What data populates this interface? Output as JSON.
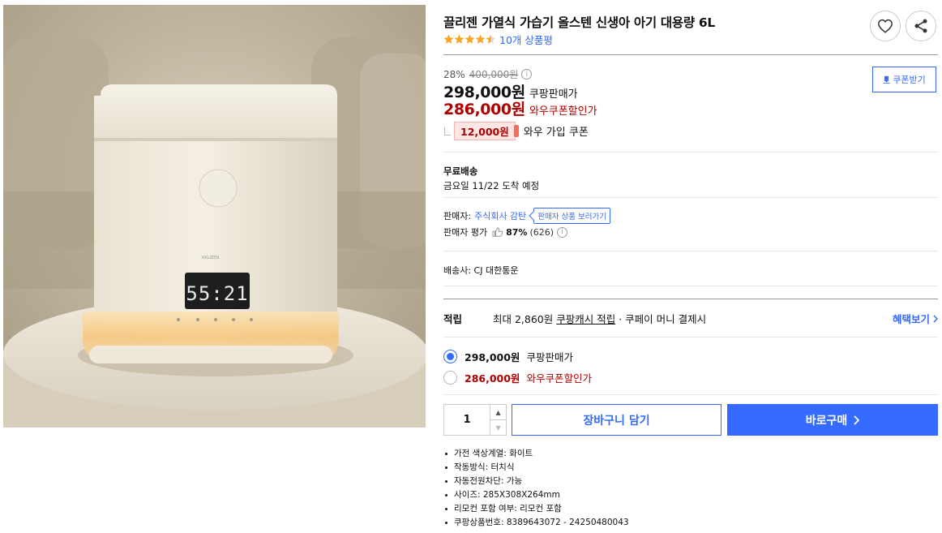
{
  "product": {
    "title": "끌리젠 가열식 가습기 올스텐 신생아 아기 대용량 6L",
    "rating": 4.5,
    "review_count": "10개 상품평",
    "device_display": "55:21"
  },
  "price": {
    "discount_rate": "28%",
    "original_price": "400,000원",
    "sale_price": "298,000원",
    "sale_label": "쿠팡판매가",
    "wow_price": "286,000원",
    "wow_label": "와우쿠폰할인가",
    "coupon_amount": "12,000원",
    "coupon_label": "와우 가입 쿠폰",
    "coupon_button": "쿠폰받기"
  },
  "shipping": {
    "title": "무료배송",
    "arrival": "금요일 11/22 도착 예정"
  },
  "seller": {
    "label": "판매자:",
    "name": "주식회사 감탄",
    "store_button": "판매자 상품 보러가기",
    "rating_label": "판매자 평가",
    "rating_pct": "87%",
    "rating_count": "(626)"
  },
  "carrier": "배송사: CJ 대한통운",
  "reward": {
    "title": "적립",
    "prefix": "최대 2,860원 ",
    "cash": "쿠팡캐시 적립",
    "suffix": " · 쿠페이 머니 결제시",
    "more": "혜택보기"
  },
  "options": [
    {
      "price": "298,000원",
      "label": "쿠팡판매가",
      "selected": true
    },
    {
      "price": "286,000원",
      "label": "와우쿠폰할인가",
      "selected": false
    }
  ],
  "purchase": {
    "quantity": "1",
    "cart_button": "장바구니 담기",
    "buy_button": "바로구매"
  },
  "specs": [
    "가전 색상계열: 화이트",
    "작동방식: 터치식",
    "자동전원차단: 가능",
    "사이즈: 285X308X264mm",
    "리모컨 포함 여부: 리모컨 포함",
    "쿠팡상품번호: 8389643072 - 24250480043"
  ],
  "colors": {
    "accent": "#346aff",
    "discount_red": "#ae0000",
    "star": "#f5a623"
  }
}
